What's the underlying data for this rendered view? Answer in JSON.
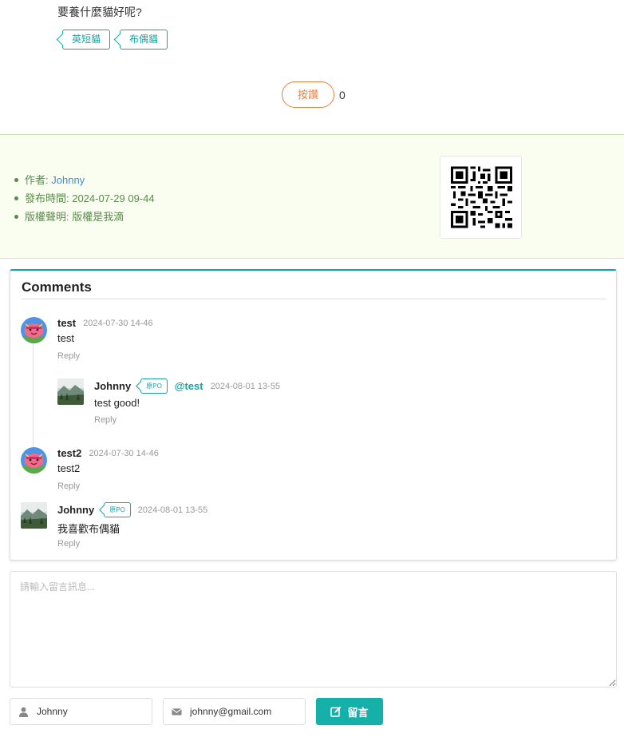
{
  "post": {
    "question": "要養什麼貓好呢?",
    "tags": [
      "英短貓",
      "布偶貓"
    ],
    "like_label": "按讚",
    "like_count": "0"
  },
  "meta": {
    "author_label": "作者: ",
    "author_name": "Johnny",
    "published_label": "發布時間: 2024-07-29 09-44",
    "copyright_label": "版權聲明: 版權是我滴"
  },
  "comments": {
    "title": "Comments",
    "items": [
      {
        "name": "test",
        "time": "2024-07-30 14-46",
        "text": "test",
        "reply": "Reply",
        "avatar": "cartoon-avatar"
      },
      {
        "name": "Johnny",
        "badge": "原PO",
        "at": "@test",
        "time": "2024-08-01 13-55",
        "text": "test good!",
        "reply": "Reply",
        "avatar": "landscape-avatar"
      },
      {
        "name": "test2",
        "time": "2024-07-30 14-46",
        "text": "test2",
        "reply": "Reply",
        "avatar": "cartoon-avatar"
      },
      {
        "name": "Johnny",
        "badge": "原PO",
        "time": "2024-08-01 13-55",
        "text": "我喜歡布偶貓",
        "reply": "Reply",
        "avatar": "landscape-avatar"
      }
    ]
  },
  "form": {
    "placeholder": "請輸入留言訊息...",
    "name_value": "Johnny",
    "email_value": "johnny@gmail.com",
    "submit_label": "留言"
  },
  "colors": {
    "accent": "#16a4a4",
    "like": "#ee7d3b",
    "meta_band": "#f9fef1",
    "meta_text": "#5a8a4a"
  },
  "icons": [
    "user-icon",
    "envelope-icon",
    "edit-icon",
    "qr-code"
  ]
}
